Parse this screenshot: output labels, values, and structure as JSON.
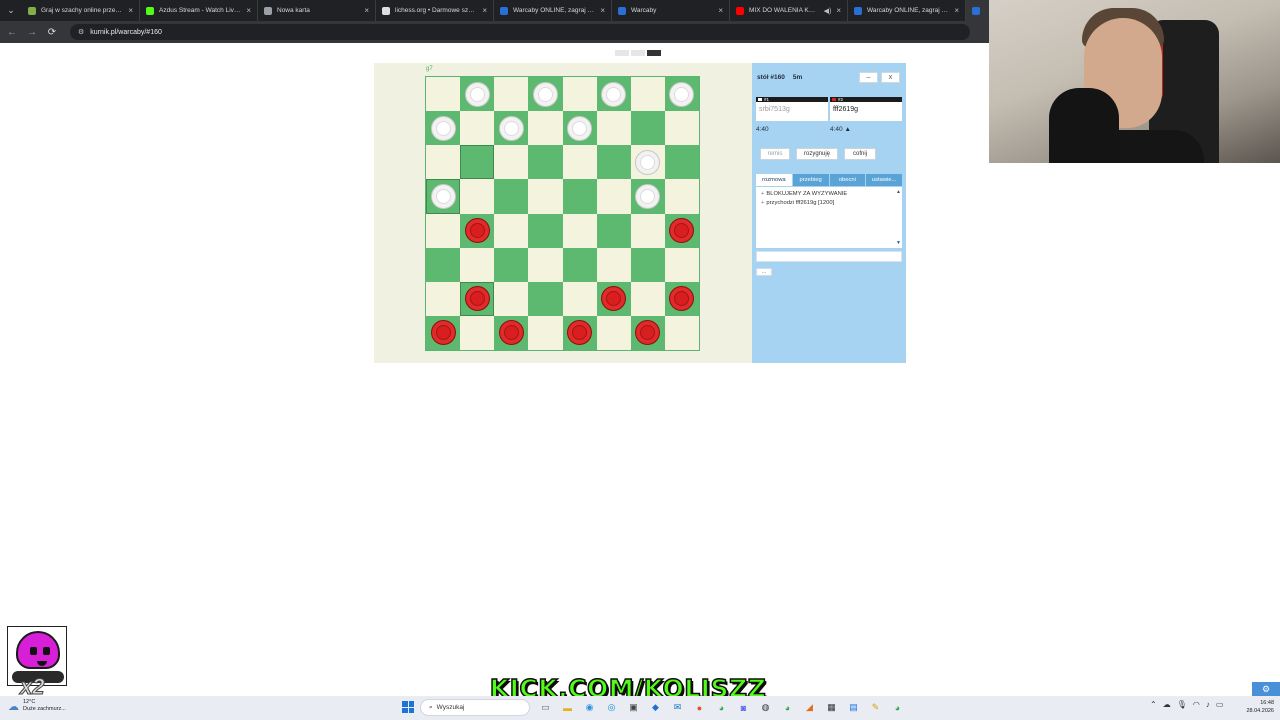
{
  "browser": {
    "tabs": [
      {
        "title": "Graj w szachy online przeciwko",
        "favicon_color": "#7fb04c",
        "active": false
      },
      {
        "title": "Azdus Stream - Watch Live on",
        "favicon_color": "#53fc18",
        "active": false
      },
      {
        "title": "Nowa karta",
        "favicon_color": "#9aa0a6",
        "active": false
      },
      {
        "title": "lichess.org • Darmowe szachy",
        "favicon_color": "#dddddd",
        "active": false
      },
      {
        "title": "Warcaby ONLINE, zagraj - Kurn",
        "favicon_color": "#2a6fd6",
        "active": false
      },
      {
        "title": "Warcaby",
        "favicon_color": "#2a6fd6",
        "active": false
      },
      {
        "title": "MIX DO WALENIA KONI",
        "favicon_color": "#ff0000",
        "active": false
      },
      {
        "title": "Warcaby ONLINE, zagraj - Kurn",
        "favicon_color": "#2a6fd6",
        "active": false
      },
      {
        "title": "",
        "favicon_color": "#2a6fd6",
        "active": true
      }
    ],
    "url": "kurnik.pl/warcaby/#160"
  },
  "game": {
    "coord_label": "g7",
    "rows": [
      ".w.w.w.w",
      "w.w.w...",
      "......w.w",
      "w.....w.",
      ".r.....r",
      "........",
      ".r...r.r",
      "r.r.r.r."
    ],
    "highlighted": [
      [
        2,
        1
      ],
      [
        3,
        0
      ],
      [
        6,
        1
      ]
    ]
  },
  "side_panel": {
    "title": "stół #160",
    "time_control": "5m",
    "minimize_label": "–",
    "close_label": "x",
    "player1": {
      "seat": "#1",
      "name": "srbi7513g",
      "clock": "4:40",
      "swatch": "#ffffff"
    },
    "player2": {
      "seat": "#2",
      "name": "fff2619g",
      "clock": "4:40 ▲",
      "swatch": "#d81e1e"
    },
    "buttons": {
      "resign": "remis",
      "surrender": "rozygnuję",
      "undo": "cofnij"
    },
    "tabs": [
      "rozmowa",
      "przebieg",
      "obecni",
      "ustawie..."
    ],
    "chat": [
      {
        "text": "BLOKUJEMY ZA WYZYWANIE"
      },
      {
        "text": "przychodzi fff2619g [1200]"
      }
    ],
    "more_label": "..."
  },
  "overlay": {
    "kick_banner": "KICK.COM/KOLISZZ",
    "emote_multiplier": "x2"
  },
  "taskbar": {
    "weather_temp": "12°C",
    "weather_desc": "Duże zachmurz...",
    "search_label": "Wyszukaj",
    "time": "16:48",
    "date": "28.04.2026"
  }
}
